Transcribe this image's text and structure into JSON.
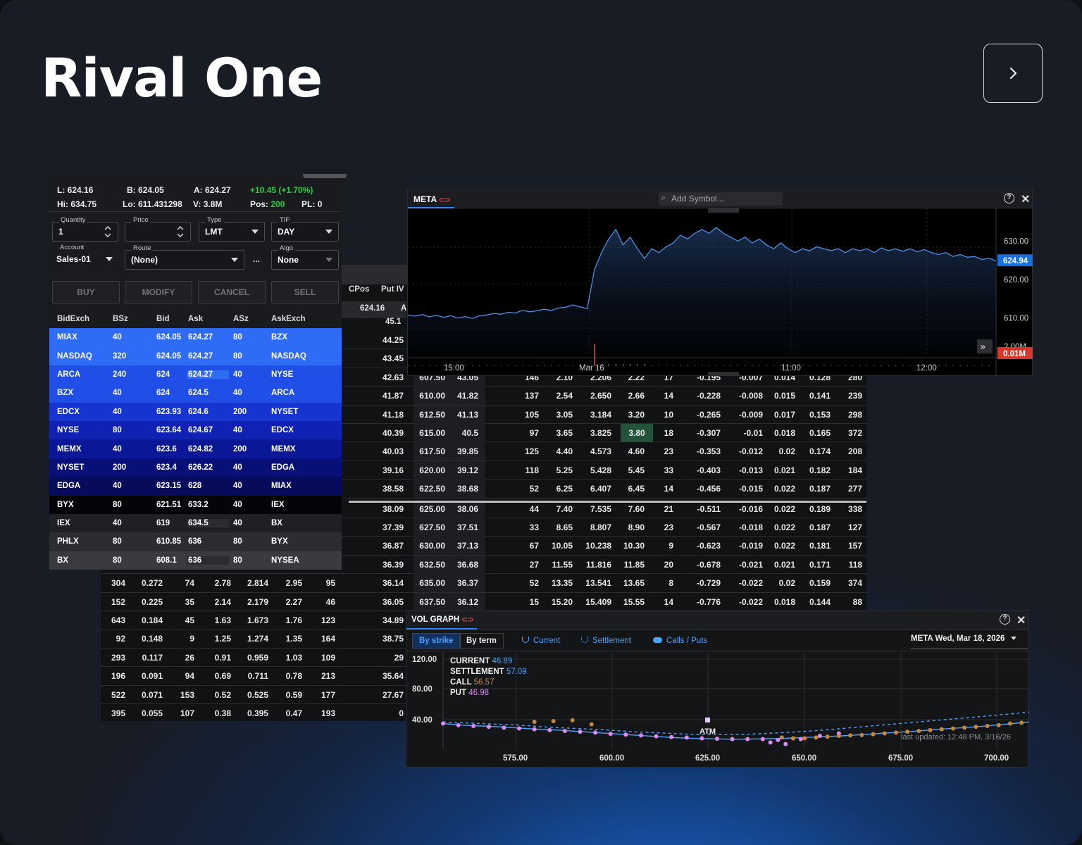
{
  "page": {
    "title": "Rival One",
    "next_icon": "chevron-right-icon"
  },
  "quote": {
    "last_label": "L:",
    "last": "624.16",
    "bid_label": "B:",
    "bid": "624.05",
    "ask_label": "A:",
    "ask": "624.27",
    "change": "+10.45 (+1.70%)",
    "hi_label": "Hi:",
    "hi": "634.75",
    "lo_label": "Lo:",
    "lo": "611.431298",
    "vol_label": "V:",
    "vol": "3.8M",
    "pos_label": "Pos:",
    "pos": "200",
    "pl_label": "PL:",
    "pl": "0"
  },
  "ticket": {
    "quantity": {
      "label": "Quantity",
      "value": "1"
    },
    "price": {
      "label": "Price",
      "value": ""
    },
    "type": {
      "label": "Type",
      "value": "LMT"
    },
    "tif": {
      "label": "TIF",
      "value": "DAY"
    },
    "account": {
      "label": "Account",
      "value": "Sales-01"
    },
    "route": {
      "label": "Route",
      "value": "(None)"
    },
    "more": "...",
    "algo": {
      "label": "Algo",
      "value": "None"
    },
    "buttons": [
      "BUY",
      "MODIFY",
      "CANCEL",
      "SELL"
    ]
  },
  "book": {
    "headers": [
      "BidExch",
      "BSz",
      "Bid",
      "Ask",
      "ASz",
      "AskExch"
    ],
    "rows": [
      [
        "MIAX",
        "40",
        "624.05",
        "624.27",
        "80",
        "BZX"
      ],
      [
        "NASDAQ",
        "320",
        "624.05",
        "624.27",
        "80",
        "NASDAQ"
      ],
      [
        "ARCA",
        "240",
        "624",
        "624.27",
        "40",
        "NYSE"
      ],
      [
        "BZX",
        "40",
        "624",
        "624.5",
        "40",
        "ARCA"
      ],
      [
        "EDCX",
        "40",
        "623.93",
        "624.6",
        "200",
        "NYSET"
      ],
      [
        "NYSE",
        "80",
        "623.64",
        "624.67",
        "40",
        "EDCX"
      ],
      [
        "MEMX",
        "40",
        "623.6",
        "624.82",
        "200",
        "MEMX"
      ],
      [
        "NYSET",
        "200",
        "623.4",
        "626.22",
        "40",
        "EDGA"
      ],
      [
        "EDGA",
        "40",
        "623.15",
        "628",
        "40",
        "MIAX"
      ],
      [
        "BYX",
        "80",
        "621.51",
        "633.2",
        "40",
        "IEX"
      ],
      [
        "IEX",
        "40",
        "619",
        "634.5",
        "40",
        "BX"
      ],
      [
        "PHLX",
        "80",
        "610.85",
        "636",
        "80",
        "BYX"
      ],
      [
        "BX",
        "80",
        "608.1",
        "636",
        "80",
        "NYSEA"
      ]
    ],
    "row_colors": [
      "#2f6cf5",
      "#2f6cf5",
      "#1f4fe6",
      "#1f4fe6",
      "#1634d0",
      "#0f22b4",
      "#0a1796",
      "#081078",
      "#060b5c",
      "#050508",
      "#1f2023",
      "#2c2d30",
      "#3a3b3e"
    ]
  },
  "chain": {
    "headers": [
      "CPos",
      "Put IV"
    ],
    "last_cell": "624.16",
    "last_cell_suffix": "A",
    "putiv_top": "45.1",
    "rows": [
      {
        "piv": "44.25"
      },
      {
        "piv": "43.45"
      },
      {
        "piv": "42.63",
        "strike": "607.50",
        "civ": "43.05",
        "a": "146",
        "b": "2.10",
        "c": "2.206",
        "d": "2.22",
        "e": "17",
        "f": "-0.195",
        "g": "-0.007",
        "h": "0.014",
        "i": "0.128",
        "j": "280"
      },
      {
        "piv": "41.87",
        "strike": "610.00",
        "civ": "41.82",
        "a": "137",
        "b": "2.54",
        "c": "2.650",
        "d": "2.66",
        "e": "14",
        "f": "-0.228",
        "g": "-0.008",
        "h": "0.015",
        "i": "0.141",
        "j": "239"
      },
      {
        "piv": "41.18",
        "strike": "612.50",
        "civ": "41.13",
        "a": "105",
        "b": "3.05",
        "c": "3.184",
        "d": "3.20",
        "e": "10",
        "f": "-0.265",
        "g": "-0.009",
        "h": "0.017",
        "i": "0.153",
        "j": "298"
      },
      {
        "piv": "40.39",
        "strike": "615.00",
        "civ": "40.5",
        "a": "97",
        "b": "3.65",
        "c": "3.825",
        "d": "3.80",
        "e": "18",
        "f": "-0.307",
        "g": "-0.01",
        "h": "0.018",
        "i": "0.165",
        "j": "372"
      },
      {
        "piv": "40.03",
        "strike": "617.50",
        "civ": "39.85",
        "a": "125",
        "b": "4.40",
        "c": "4.573",
        "d": "4.60",
        "e": "23",
        "f": "-0.353",
        "g": "-0.012",
        "h": "0.02",
        "i": "0.174",
        "j": "208"
      },
      {
        "piv": "39.16",
        "strike": "620.00",
        "civ": "39.12",
        "a": "118",
        "b": "5.25",
        "c": "5.428",
        "d": "5.45",
        "e": "33",
        "f": "-0.403",
        "g": "-0.013",
        "h": "0.021",
        "i": "0.182",
        "j": "184"
      },
      {
        "piv": "38.58",
        "strike": "622.50",
        "civ": "38.68",
        "a": "52",
        "b": "6.25",
        "c": "6.407",
        "d": "6.45",
        "e": "14",
        "f": "-0.456",
        "g": "-0.015",
        "h": "0.022",
        "i": "0.187",
        "j": "277"
      },
      {
        "piv": "38.09",
        "strike": "625.00",
        "civ": "38.06",
        "a": "44",
        "b": "7.40",
        "c": "7.535",
        "d": "7.60",
        "e": "21",
        "f": "-0.511",
        "g": "-0.016",
        "h": "0.022",
        "i": "0.189",
        "j": "338"
      },
      {
        "piv": "37.39",
        "strike": "627.50",
        "civ": "37.51",
        "a": "33",
        "b": "8.65",
        "c": "8.807",
        "d": "8.90",
        "e": "23",
        "f": "-0.567",
        "g": "-0.018",
        "h": "0.022",
        "i": "0.187",
        "j": "127"
      },
      {
        "piv": "36.87",
        "strike": "630.00",
        "civ": "37.13",
        "a": "67",
        "b": "10.05",
        "c": "10.238",
        "d": "10.30",
        "e": "9",
        "f": "-0.623",
        "g": "-0.019",
        "h": "0.022",
        "i": "0.181",
        "j": "157"
      },
      {
        "piv": "36.39",
        "strike": "632.50",
        "civ": "36.68",
        "a": "27",
        "b": "11.55",
        "c": "11.816",
        "d": "11.85",
        "e": "20",
        "f": "-0.678",
        "g": "-0.021",
        "h": "0.021",
        "i": "0.171",
        "j": "118"
      },
      {
        "l1": "304",
        "l2": "0.272",
        "l3": "74",
        "l4": "2.78",
        "l5": "2.814",
        "l6": "2.95",
        "l7": "95",
        "piv": "36.14",
        "strike": "635.00",
        "civ": "36.37",
        "a": "52",
        "b": "13.35",
        "c": "13.541",
        "d": "13.65",
        "e": "8",
        "f": "-0.729",
        "g": "-0.022",
        "h": "0.02",
        "i": "0.159",
        "j": "374"
      },
      {
        "l1": "152",
        "l2": "0.225",
        "l3": "35",
        "l4": "2.14",
        "l5": "2.179",
        "l6": "2.27",
        "l7": "46",
        "piv": "36.05",
        "strike": "637.50",
        "civ": "36.12",
        "a": "15",
        "b": "15.20",
        "c": "15.409",
        "d": "15.55",
        "e": "14",
        "f": "-0.776",
        "g": "-0.022",
        "h": "0.018",
        "i": "0.144",
        "j": "88"
      },
      {
        "l1": "643",
        "l2": "0.184",
        "l3": "45",
        "l4": "1.63",
        "l5": "1.673",
        "l6": "1.76",
        "l7": "123",
        "piv": "34.89"
      },
      {
        "l1": "92",
        "l2": "0.148",
        "l3": "9",
        "l4": "1.25",
        "l5": "1.274",
        "l6": "1.35",
        "l7": "164",
        "piv": "38.75"
      },
      {
        "l1": "293",
        "l2": "0.117",
        "l3": "26",
        "l4": "0.91",
        "l5": "0.959",
        "l6": "1.03",
        "l7": "109",
        "piv": "29"
      },
      {
        "l1": "196",
        "l2": "0.091",
        "l3": "94",
        "l4": "0.69",
        "l5": "0.711",
        "l6": "0.78",
        "l7": "213",
        "piv": "35.64"
      },
      {
        "l1": "522",
        "l2": "0.071",
        "l3": "153",
        "l4": "0.52",
        "l5": "0.525",
        "l6": "0.59",
        "l7": "177",
        "piv": "27.67"
      },
      {
        "l1": "395",
        "l2": "0.055",
        "l3": "107",
        "l4": "0.38",
        "l5": "0.395",
        "l6": "0.47",
        "l7": "193",
        "piv": "0"
      }
    ]
  },
  "price_chart": {
    "symbol": "META",
    "search_placeholder": "Add Symbol...",
    "y_ticks": [
      "630.00",
      "620.00",
      "610.00"
    ],
    "vol_tick": "2.00M",
    "x_ticks": [
      "15:00",
      "Mar 16",
      "11:00",
      "12:00"
    ],
    "last_price": "624.94",
    "last_volume": "0.01M",
    "accent": "#2f86ff",
    "chart_data": {
      "type": "area",
      "ylim": [
        605,
        637
      ],
      "values": [
        610.8,
        610.5,
        610.9,
        610.3,
        610.7,
        610.2,
        610.6,
        610.0,
        610.4,
        609.9,
        610.6,
        610.8,
        611.2,
        611.0,
        611.5,
        611.3,
        612.0,
        611.6,
        611.9,
        612.3,
        612.0,
        612.6,
        612.8,
        613.4,
        612.9,
        612.4,
        622.5,
        627.0,
        630.5,
        633.0,
        629.0,
        631.0,
        628.0,
        625.5,
        628.0,
        627.0,
        628.5,
        629.5,
        631.5,
        630.5,
        632.0,
        633.0,
        632.0,
        633.5,
        632.0,
        631.0,
        630.0,
        631.0,
        629.5,
        630.5,
        629.0,
        628.0,
        629.5,
        628.0,
        627.0,
        628.0,
        627.5,
        628.5,
        628.0,
        627.5,
        628.0,
        627.0,
        628.0,
        627.5,
        628.0,
        627.0,
        628.2,
        627.5,
        628.0,
        627.3,
        628.0,
        627.2,
        627.8,
        627.0,
        626.5,
        627.0,
        626.0,
        626.5,
        625.8,
        626.0,
        625.2,
        625.5,
        624.9
      ]
    }
  },
  "vol_graph": {
    "title": "VOL GRAPH",
    "tabs": [
      "By strike",
      "By term"
    ],
    "legend": [
      "Current",
      "Settlement",
      "Calls / Puts"
    ],
    "expiry": "META Wed, Mar 18, 2026",
    "y_ticks": [
      "120.00",
      "80.00",
      "40.00"
    ],
    "x_ticks": [
      "575.00",
      "600.00",
      "625.00",
      "650.00",
      "675.00",
      "700.00"
    ],
    "readouts": [
      {
        "label": "CURRENT",
        "value": "46.89",
        "color": "#4aa3ff"
      },
      {
        "label": "SETTLEMENT",
        "value": "57.09",
        "color": "#4aa3ff"
      },
      {
        "label": "CALL",
        "value": "56.57",
        "color": "#c8873a"
      },
      {
        "label": "PUT",
        "value": "46.98",
        "color": "#d98cf5"
      }
    ],
    "atm_label": "ATM",
    "updated": "last updated: 12:48 PM, 3/16/26",
    "chart_data": {
      "type": "scatter",
      "xlim": [
        556,
        710
      ],
      "ylim": [
        20,
        140
      ],
      "x": [
        556,
        561,
        566,
        571,
        576,
        581,
        586,
        591,
        596,
        601,
        606,
        611,
        616,
        621,
        626,
        631,
        636,
        641,
        646,
        651,
        656,
        661,
        666,
        671,
        676,
        681,
        686,
        691,
        696,
        701,
        706,
        710
      ],
      "current": [
        53,
        51,
        50,
        49,
        47.5,
        46,
        45,
        43.5,
        42,
        40.5,
        39,
        37.5,
        36,
        35,
        34.5,
        34,
        34,
        34.5,
        35,
        36,
        37,
        38,
        39.5,
        41,
        42.5,
        44,
        46,
        47.5,
        49,
        51,
        53,
        55
      ],
      "settlement": [
        55,
        54,
        53,
        52,
        51,
        49.5,
        48,
        47,
        46,
        44.5,
        43,
        42,
        41,
        40,
        39.5,
        39.5,
        40,
        41,
        42,
        43.5,
        45,
        47,
        49,
        51,
        53,
        55,
        57,
        59,
        61,
        63,
        65,
        67
      ],
      "calls_x": [
        580,
        585,
        590,
        595,
        645,
        648,
        651,
        654,
        657,
        660,
        663,
        666,
        669,
        672,
        675,
        678,
        681,
        684,
        687,
        690,
        693,
        696,
        699,
        702,
        705,
        708
      ],
      "calls": [
        55,
        56,
        57,
        52,
        36,
        35,
        35,
        36,
        37,
        38,
        38.5,
        39,
        40,
        41,
        42,
        43,
        44,
        45,
        46,
        47,
        48,
        49,
        50,
        51,
        53,
        54
      ],
      "puts_x": [
        556,
        560,
        564,
        568,
        572,
        576,
        580,
        584,
        588,
        592,
        596,
        600,
        604,
        608,
        612,
        616,
        620,
        624,
        628,
        632,
        636,
        640,
        642,
        644,
        646,
        648,
        650,
        655,
        660
      ],
      "puts": [
        53,
        51,
        50,
        49,
        48,
        47,
        46,
        45,
        44,
        43,
        42,
        40.5,
        39.5,
        38.5,
        37.5,
        36.5,
        36,
        35,
        34.5,
        34,
        34,
        34,
        30,
        33,
        28,
        35,
        34,
        38,
        41
      ]
    }
  }
}
